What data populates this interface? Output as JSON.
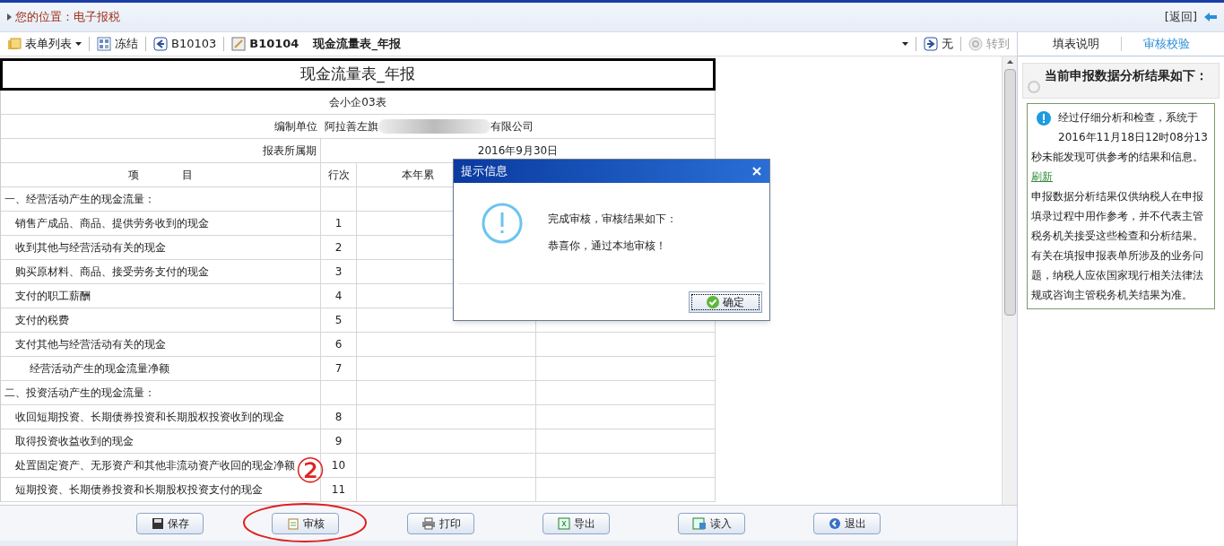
{
  "breadcrumb": {
    "label": "您的位置：",
    "value": "电子报税",
    "back": "[返回]"
  },
  "toolbar": {
    "items": [
      {
        "kind": "list",
        "label": "表单列表"
      },
      {
        "kind": "freeze",
        "label": "冻结"
      },
      {
        "kind": "prev",
        "label": "B10103"
      },
      {
        "kind": "current",
        "label": "B10104",
        "title": "现金流量表_年报"
      }
    ],
    "right": [
      {
        "kind": "next",
        "label": "无",
        "disabled": false
      },
      {
        "kind": "goto",
        "label": "转到",
        "disabled": true
      }
    ]
  },
  "form": {
    "title": "现金流量表_年报",
    "code": "会小企03表",
    "unit_label": "编制单位",
    "unit_prefix": "阿拉善左旗",
    "unit_suffix": "有限公司",
    "period_label": "报表所属期",
    "period": "2016年9月30日",
    "columns": [
      "项　　　　目",
      "行次",
      "本年累"
    ],
    "rows": [
      {
        "kind": "section",
        "item": "一、经营活动产生的现金流量："
      },
      {
        "kind": "item",
        "item": "销售产成品、商品、提供劳务收到的现金",
        "line": "1"
      },
      {
        "kind": "item",
        "item": "收到其他与经营活动有关的现金",
        "line": "2"
      },
      {
        "kind": "item",
        "item": "购买原材料、商品、接受劳务支付的现金",
        "line": "3"
      },
      {
        "kind": "item",
        "item": "支付的职工薪酬",
        "line": "4"
      },
      {
        "kind": "item",
        "item": "支付的税费",
        "line": "5"
      },
      {
        "kind": "item",
        "item": "支付其他与经营活动有关的现金",
        "line": "6"
      },
      {
        "kind": "subtotal",
        "item": "经营活动产生的现金流量净额",
        "line": "7"
      },
      {
        "kind": "section",
        "item": "二、投资活动产生的现金流量："
      },
      {
        "kind": "item",
        "item": "收回短期投资、长期债券投资和长期股权投资收到的现金",
        "line": "8"
      },
      {
        "kind": "item",
        "item": "取得投资收益收到的现金",
        "line": "9"
      },
      {
        "kind": "item",
        "item": "处置固定资产、无形资产和其他非流动资产收回的现金净额",
        "line": "10"
      },
      {
        "kind": "item",
        "item": "短期投资、长期债券投资和长期股权投资支付的现金",
        "line": "11"
      }
    ]
  },
  "buttons": [
    {
      "kind": "save",
      "label": "保存"
    },
    {
      "kind": "audit",
      "label": "审核"
    },
    {
      "kind": "print",
      "label": "打印"
    },
    {
      "kind": "export",
      "label": "导出"
    },
    {
      "kind": "import",
      "label": "读入"
    },
    {
      "kind": "exit",
      "label": "退出"
    }
  ],
  "side": {
    "tabs": [
      {
        "label": "填表说明",
        "selected": false
      },
      {
        "label": "审核校验",
        "selected": true
      }
    ],
    "heading": "当前申报数据分析结果如下：",
    "message": "经过仔细分析和检查，系统于 2016年11月18日12时08分13秒未能发现可供参考的结果和信息。",
    "link": "刷新",
    "note": "申报数据分析结果仅供纳税人在申报填录过程中用作参考，并不代表主管税务机关接受这些检查和分析结果。有关在填报申报表单所涉及的业务问题，纳税人应依国家现行相关法律法规或咨询主管税务机关结果为准。"
  },
  "dialog": {
    "title": "提示信息",
    "lines": [
      "完成审核，审核结果如下：",
      "恭喜你，通过本地审核！"
    ],
    "ok": "确定"
  },
  "annotation": {
    "label": "②"
  }
}
